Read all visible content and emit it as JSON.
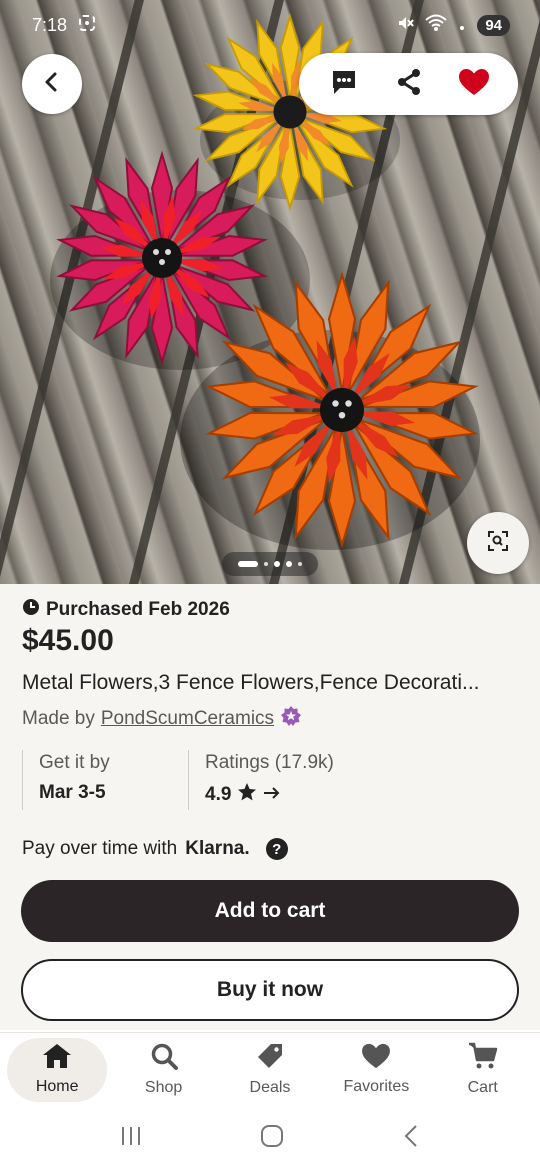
{
  "status_bar": {
    "time": "7:18",
    "battery": "94"
  },
  "gallery": {
    "image_count": 5,
    "current_index": 1
  },
  "product": {
    "purchased": "Purchased Feb 2026",
    "price": "$45.00",
    "title": "Metal Flowers,3 Fence Flowers,Fence Decorati...",
    "made_by_label": "Made by",
    "shop_name": "PondScumCeramics",
    "delivery_label": "Get it by",
    "delivery_value": "Mar 3-5",
    "ratings_label": "Ratings (17.9k)",
    "ratings_value": "4.9",
    "klarna_text": "Pay over time with",
    "klarna_brand": "Klarna."
  },
  "buttons": {
    "add_to_cart": "Add to cart",
    "buy_now": "Buy it now"
  },
  "bottom_nav": {
    "items": [
      {
        "label": "Home",
        "icon": "home-icon",
        "active": true
      },
      {
        "label": "Shop",
        "icon": "search-icon"
      },
      {
        "label": "Deals",
        "icon": "tag-icon"
      },
      {
        "label": "Favorites",
        "icon": "heart-icon"
      },
      {
        "label": "Cart",
        "icon": "cart-icon"
      }
    ]
  },
  "colors": {
    "primary_button": "#2c2528",
    "favorite": "#d0021b",
    "star_badge": "#9b59b6"
  }
}
